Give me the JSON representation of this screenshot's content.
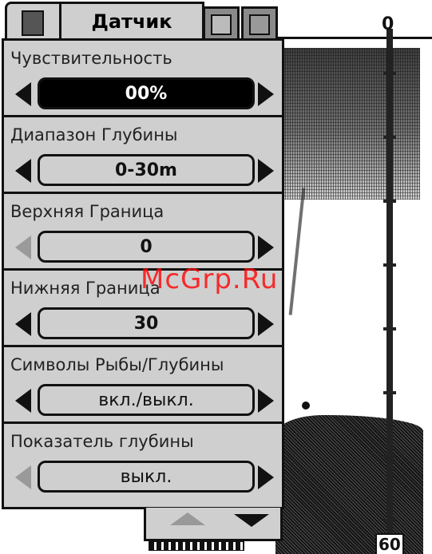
{
  "menu": {
    "title": "Датчик",
    "icons": [
      "sonar-tab-icon",
      "chart-tab-icon",
      "settings-tab-icon"
    ]
  },
  "items": [
    {
      "label": "Чувствительность",
      "value": "00%",
      "selected": true,
      "left_enabled": true
    },
    {
      "label": "Диапазон Глубины",
      "value": "0-30m",
      "selected": false,
      "left_enabled": true
    },
    {
      "label": "Верхняя Граница",
      "value": "0",
      "selected": false,
      "left_enabled": false
    },
    {
      "label": "Нижняя Граница",
      "value": "30",
      "selected": false,
      "left_enabled": true
    },
    {
      "label": "Символы Рыбы/Глубины",
      "value": "вкл./выкл.",
      "selected": false,
      "left_enabled": true
    },
    {
      "label": "Показатель глубины",
      "value": "выкл.",
      "selected": false,
      "left_enabled": false
    }
  ],
  "sonar": {
    "depth_top": "0",
    "depth_bottom": "60"
  },
  "watermark": "McGrp.Ru"
}
